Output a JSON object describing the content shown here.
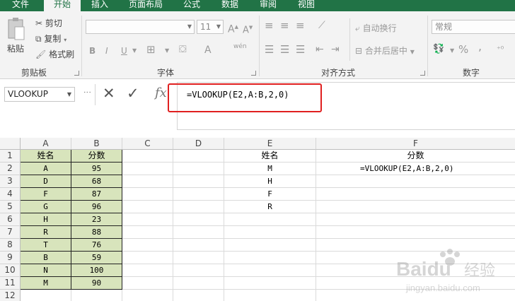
{
  "ribbon_tabs": [
    "文件",
    "开始",
    "插入",
    "页面布局",
    "公式",
    "数据",
    "审阅",
    "视图"
  ],
  "clipboard": {
    "paste": "粘贴",
    "cut": "剪切",
    "copy": "复制",
    "format_painter": "格式刷",
    "group": "剪贴板"
  },
  "font": {
    "font_name": "",
    "font_size": "11",
    "grow": "A",
    "shrink": "A",
    "bold": "B",
    "italic": "I",
    "underline": "U",
    "font_color": "A",
    "phonetic": "wén",
    "group": "字体"
  },
  "alignment": {
    "wrap_text": "自动换行",
    "merge_center": "合并后居中",
    "group": "对齐方式"
  },
  "number": {
    "format": "常规",
    "percent": "%",
    "comma": ",",
    "group": "数字"
  },
  "formula_bar": {
    "name_box": "VLOOKUP",
    "fx": "fx",
    "formula": "=VLOOKUP(E2,A:B,2,0)"
  },
  "columns": [
    "A",
    "B",
    "C",
    "D",
    "E",
    "F"
  ],
  "rows": [
    "1",
    "2",
    "3",
    "4",
    "5",
    "6",
    "7",
    "8",
    "9",
    "10",
    "11",
    "12"
  ],
  "table": {
    "header_name": "姓名",
    "header_score": "分数",
    "records": [
      {
        "name": "A",
        "score": "95"
      },
      {
        "name": "D",
        "score": "68"
      },
      {
        "name": "F",
        "score": "87"
      },
      {
        "name": "G",
        "score": "96"
      },
      {
        "name": "H",
        "score": "23"
      },
      {
        "name": "R",
        "score": "88"
      },
      {
        "name": "T",
        "score": "76"
      },
      {
        "name": "B",
        "score": "59"
      },
      {
        "name": "N",
        "score": "100"
      },
      {
        "name": "M",
        "score": "90"
      }
    ]
  },
  "lookup": {
    "header_name": "姓名",
    "header_score": "分数",
    "names": [
      "M",
      "H",
      "F",
      "R"
    ],
    "f2": "=VLOOKUP(E2,A:B,2,0)"
  },
  "watermark": {
    "brand": "Baidu",
    "cn": "经验",
    "url": "jingyan.baidu.com"
  },
  "colors": {
    "excel_green": "#217346",
    "table_fill": "#d8e4bc",
    "highlight": "#e02020"
  }
}
